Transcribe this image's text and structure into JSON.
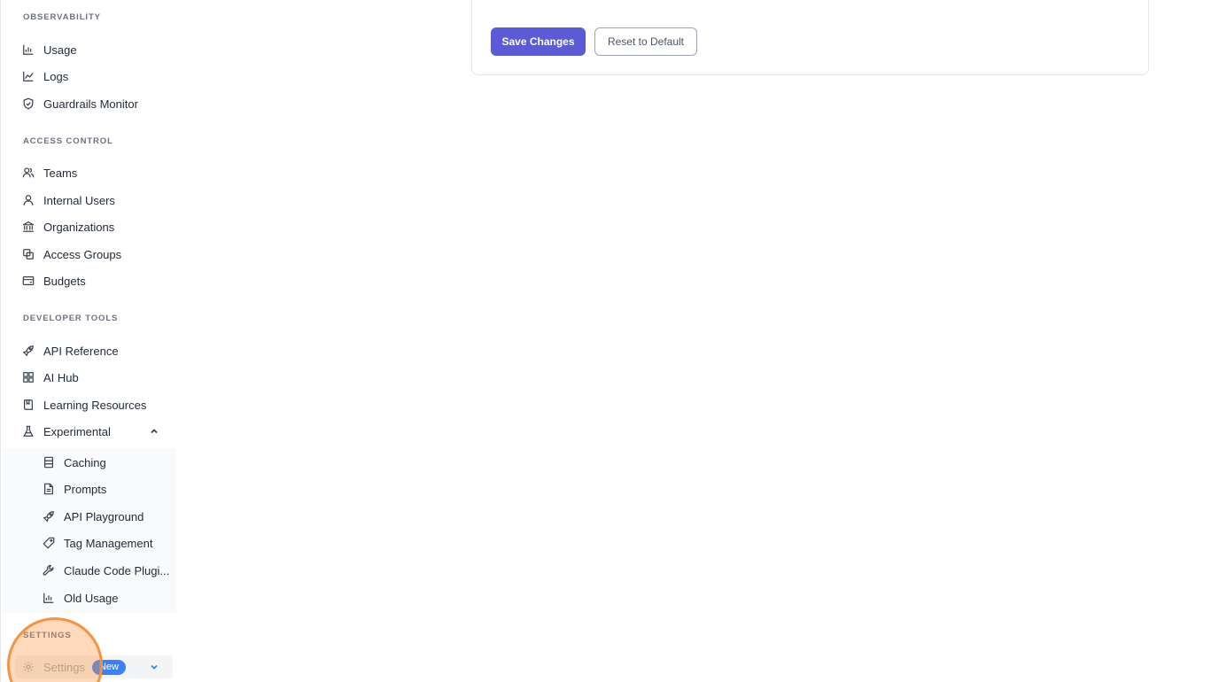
{
  "sidebar": {
    "sections": {
      "observability": "OBSERVABILITY",
      "access_control": "ACCESS CONTROL",
      "developer_tools": "DEVELOPER TOOLS",
      "settings": "SETTINGS"
    },
    "observability_items": [
      {
        "label": "Usage",
        "icon": "bar-chart-icon"
      },
      {
        "label": "Logs",
        "icon": "line-chart-icon"
      },
      {
        "label": "Guardrails Monitor",
        "icon": "shield-check-icon"
      }
    ],
    "access_items": [
      {
        "label": "Teams",
        "icon": "users-icon"
      },
      {
        "label": "Internal Users",
        "icon": "user-icon"
      },
      {
        "label": "Organizations",
        "icon": "bank-icon"
      },
      {
        "label": "Access Groups",
        "icon": "copy-icon"
      },
      {
        "label": "Budgets",
        "icon": "credit-card-icon"
      }
    ],
    "developer_items": [
      {
        "label": "API Reference",
        "icon": "rocket-icon"
      },
      {
        "label": "AI Hub",
        "icon": "grid-icon"
      },
      {
        "label": "Learning Resources",
        "icon": "book-icon"
      },
      {
        "label": "Experimental",
        "icon": "flask-icon",
        "expanded": true
      }
    ],
    "experimental_items": [
      {
        "label": "Caching",
        "icon": "database-icon"
      },
      {
        "label": "Prompts",
        "icon": "file-text-icon"
      },
      {
        "label": "API Playground",
        "icon": "rocket-icon"
      },
      {
        "label": "Tag Management",
        "icon": "tag-icon"
      },
      {
        "label": "Claude Code Plugi...",
        "icon": "wrench-icon"
      },
      {
        "label": "Old Usage",
        "icon": "bar-chart-icon"
      }
    ],
    "settings_item": {
      "label": "Settings",
      "badge": "New",
      "icon": "gear-icon"
    }
  },
  "main": {
    "save_label": "Save Changes",
    "reset_label": "Reset to Default"
  },
  "colors": {
    "primary": "#5b5bd6",
    "badge": "#3b82f6",
    "highlight": "#f59342"
  }
}
